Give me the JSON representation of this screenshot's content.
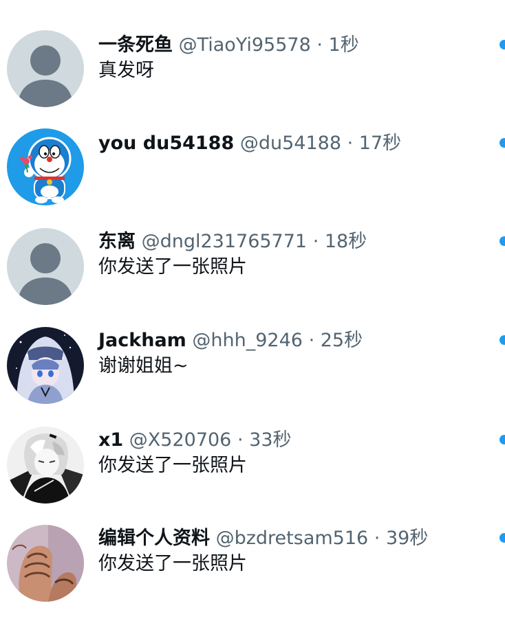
{
  "conversations": [
    {
      "display_name": "一条死鱼",
      "handle": "@TiaoYi95578",
      "separator": "·",
      "time": "1秒",
      "preview": "真发呀",
      "avatar": "default-avatar-icon",
      "unread": true
    },
    {
      "display_name": "you du54188",
      "handle": "@du54188",
      "separator": "·",
      "time": "17秒",
      "preview": "",
      "avatar": "doraemon-avatar",
      "unread": true
    },
    {
      "display_name": "东离",
      "handle": "@dngl231765771",
      "separator": "·",
      "time": "18秒",
      "preview": "你发送了一张照片",
      "avatar": "default-avatar-icon",
      "unread": true
    },
    {
      "display_name": "Jackham",
      "handle": "@hhh_9246",
      "separator": "·",
      "time": "25秒",
      "preview": "谢谢姐姐~",
      "avatar": "anime-shark-hood-avatar",
      "unread": true
    },
    {
      "display_name": "x1",
      "handle": "@X520706",
      "separator": "·",
      "time": "33秒",
      "preview": "你发送了一张照片",
      "avatar": "monochrome-anime-avatar",
      "unread": true
    },
    {
      "display_name": "编辑个人资料",
      "handle": "@bzdretsam516",
      "separator": "·",
      "time": "39秒",
      "preview": "你发送了一张照片",
      "avatar": "hands-photo-avatar",
      "unread": true
    }
  ],
  "colors": {
    "unread_dot": "#1d9bf0",
    "secondary_text": "#536471",
    "primary_text": "#0f1419",
    "default_avatar_bg": "#cfd9de",
    "default_avatar_fg": "#6b7a86"
  }
}
